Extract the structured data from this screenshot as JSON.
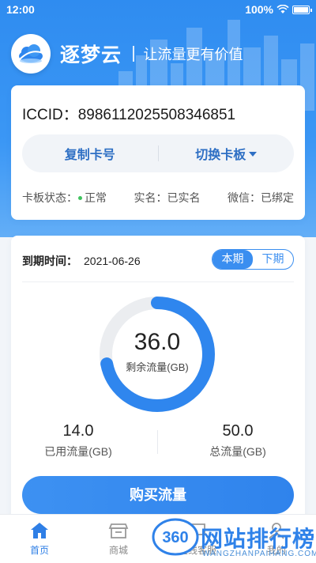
{
  "status_bar": {
    "time": "12:00",
    "battery": "100%"
  },
  "brand": {
    "name": "逐梦云",
    "slogan": "让流量更有价值"
  },
  "sim_card": {
    "iccid_label": "ICCID：",
    "iccid_value": "89861120255083468​51",
    "copy_button": "复制卡号",
    "switch_button": "切换卡板",
    "status_label": "卡板状态：",
    "status_value": "正常",
    "realname_label": "实名：",
    "realname_value": "已实名",
    "wechat_label": "微信：",
    "wechat_value": "已绑定",
    "status_color": "#3fc35e"
  },
  "usage": {
    "expire_label": "到期时间：",
    "expire_date": "2021-06-26",
    "period_tabs": [
      "本期",
      "下期"
    ],
    "active_period": "本期",
    "remaining_value": "36.0",
    "remaining_label": "剩余流量(GB)",
    "used_value": "14.0",
    "used_label": "已用流量(GB)",
    "total_value": "50.0",
    "total_label": "总流量(GB)",
    "remaining_fraction": 0.72,
    "ring_color": "#2f86ee",
    "ring_track_color": "#ebedf0",
    "buy_button": "购买流量"
  },
  "tabbar": {
    "items": [
      {
        "label": "首页",
        "icon": "home-icon",
        "active": true
      },
      {
        "label": "商城",
        "icon": "store-icon",
        "active": false
      },
      {
        "label": "在线客服",
        "icon": "chat-icon",
        "active": false
      },
      {
        "label": "我的",
        "icon": "user-icon",
        "active": false
      }
    ]
  },
  "watermark": {
    "badge": "360",
    "text": "网站排行榜",
    "sub": "WANGZHANPAIHANG.COM"
  },
  "colors": {
    "primary": "#2f8cf0",
    "accent_text": "#2e6fc4"
  }
}
